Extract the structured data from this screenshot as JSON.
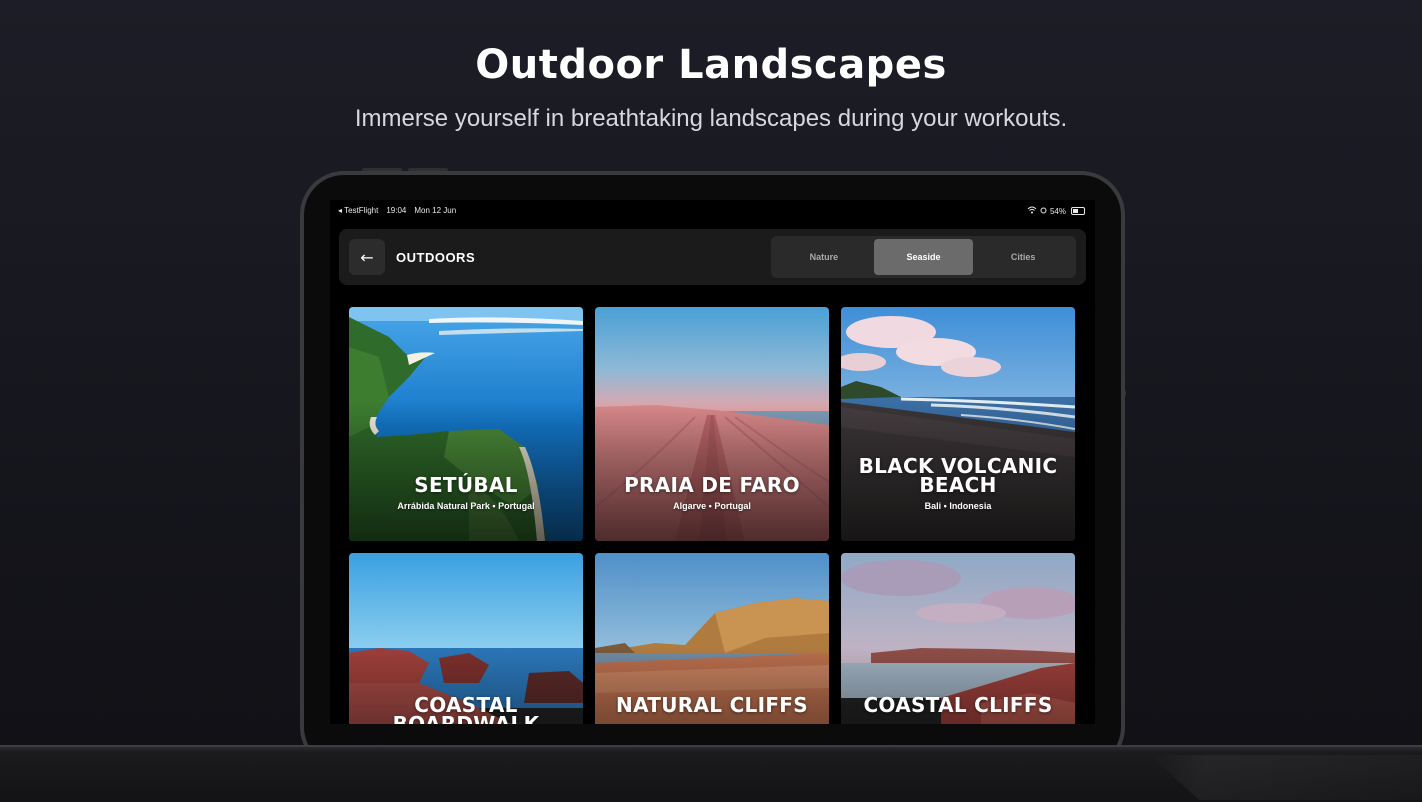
{
  "hero": {
    "title": "Outdoor Landscapes",
    "subtitle": "Immerse yourself in breathtaking landscapes during your workouts."
  },
  "status_bar": {
    "back_app": "◂ TestFlight",
    "time": "19:04",
    "date": "Mon 12 Jun",
    "battery_text": "54%",
    "battery_level": 0.54
  },
  "header": {
    "back_icon": "arrow-left-icon",
    "back_glyph": "←",
    "title": "OUTDOORS"
  },
  "tabs": [
    {
      "label": "Nature",
      "active": false
    },
    {
      "label": "Seaside",
      "active": true
    },
    {
      "label": "Cities",
      "active": false
    }
  ],
  "cards": [
    {
      "title": "SETÚBAL",
      "subtitle": "Arrábida Natural Park • Portugal"
    },
    {
      "title": "PRAIA DE FARO",
      "subtitle": "Algarve • Portugal"
    },
    {
      "title": "BLACK VOLCANIC BEACH",
      "subtitle": "Bali • Indonesia"
    },
    {
      "title": "COASTAL BOARDWALK",
      "subtitle": ""
    },
    {
      "title": "NATURAL CLIFFS",
      "subtitle": ""
    },
    {
      "title": "COASTAL CLIFFS",
      "subtitle": ""
    }
  ],
  "colors": {
    "background": "#17171e",
    "accent_active_tab": "#6b6b6b",
    "topbar": "#1b1b1b"
  }
}
